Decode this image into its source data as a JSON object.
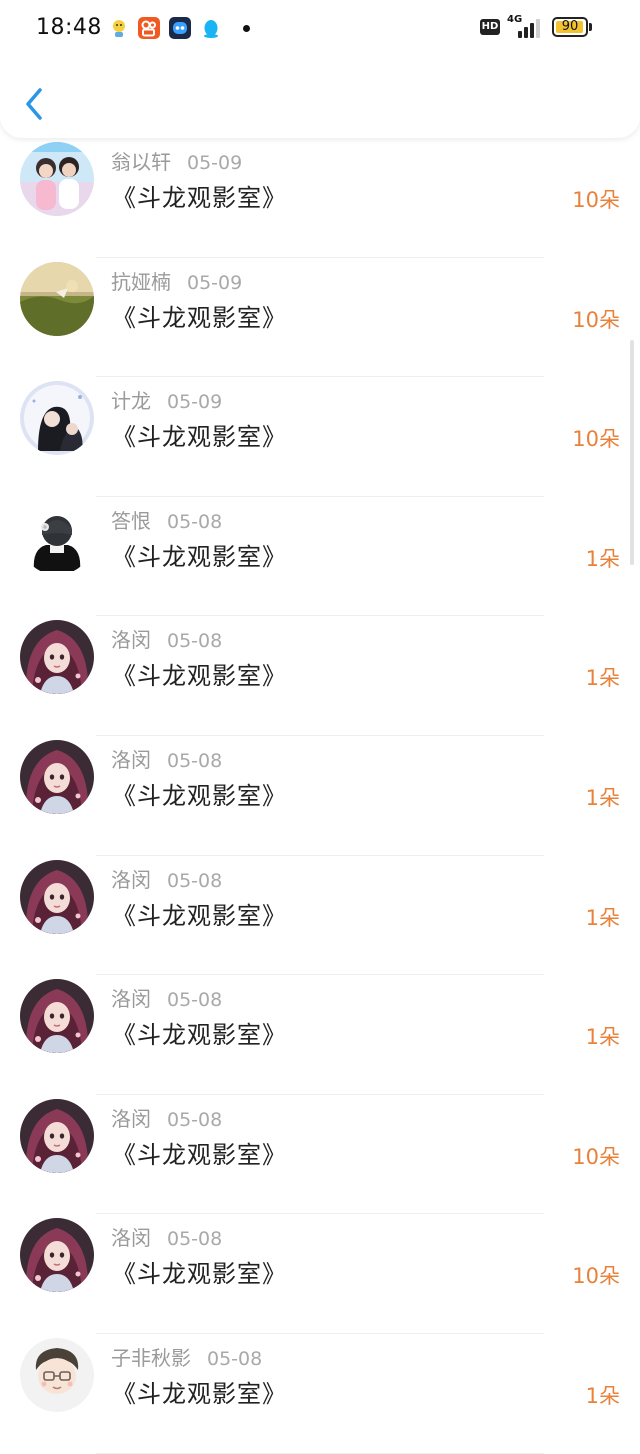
{
  "status_bar": {
    "time": "18:48",
    "hd_label": "HD",
    "network_label": "4G",
    "battery_level": "90",
    "notification_icons": [
      "avatar-app-icon",
      "kuaishou-app-icon",
      "robot-app-icon",
      "qq-penguin-icon"
    ]
  },
  "colors": {
    "accent_blue": "#2a96e8",
    "gift_orange": "#e8823a",
    "battery_yellow": "#f2c230"
  },
  "header": {
    "back_icon": "chevron-left-icon"
  },
  "records": [
    {
      "name": "翁以轩",
      "date": "05-09",
      "title": "《斗龙观影室》",
      "gift": "10朵",
      "avatar_style": "couple-photo"
    },
    {
      "name": "抗娅楠",
      "date": "05-09",
      "title": "《斗龙观影室》",
      "gift": "10朵",
      "avatar_style": "meadow-photo"
    },
    {
      "name": "计龙",
      "date": "05-09",
      "title": "《斗龙观影室》",
      "gift": "10朵",
      "avatar_style": "anime-pair"
    },
    {
      "name": "答恨",
      "date": "05-08",
      "title": "《斗龙观影室》",
      "gift": "1朵",
      "avatar_style": "chibi-boy"
    },
    {
      "name": "洛闵",
      "date": "05-08",
      "title": "《斗龙观影室》",
      "gift": "1朵",
      "avatar_style": "anime-girl"
    },
    {
      "name": "洛闵",
      "date": "05-08",
      "title": "《斗龙观影室》",
      "gift": "1朵",
      "avatar_style": "anime-girl"
    },
    {
      "name": "洛闵",
      "date": "05-08",
      "title": "《斗龙观影室》",
      "gift": "1朵",
      "avatar_style": "anime-girl"
    },
    {
      "name": "洛闵",
      "date": "05-08",
      "title": "《斗龙观影室》",
      "gift": "1朵",
      "avatar_style": "anime-girl"
    },
    {
      "name": "洛闵",
      "date": "05-08",
      "title": "《斗龙观影室》",
      "gift": "10朵",
      "avatar_style": "anime-girl"
    },
    {
      "name": "洛闵",
      "date": "05-08",
      "title": "《斗龙观影室》",
      "gift": "10朵",
      "avatar_style": "anime-girl"
    },
    {
      "name": "子非秋影",
      "date": "05-08",
      "title": "《斗龙观影室》",
      "gift": "1朵",
      "avatar_style": "cartoon-boy"
    }
  ]
}
